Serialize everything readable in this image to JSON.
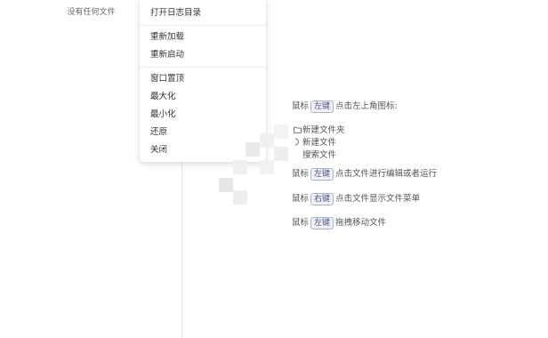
{
  "sidebar": {
    "empty_text": "没有任何文件"
  },
  "context_menu": {
    "open_log_dir": "打开日志目录",
    "reload": "重新加载",
    "restart": "重新启动",
    "always_on_top": "窗口置顶",
    "maximize": "最大化",
    "minimize": "最小化",
    "restore": "还原",
    "close": "关闭"
  },
  "hints": {
    "mouse": "鼠标",
    "left_key": "左键",
    "right_key": "右键",
    "click_top_left_icon": "点击左上角图标:",
    "new_folder": "新建文件夹",
    "new_file": "新建文件",
    "search_file": "搜索文件",
    "click_edit_run": "点击文件进行编辑或者运行",
    "click_show_menu": "点击文件显示文件菜单",
    "drag_move": "拖拽移动文件"
  }
}
